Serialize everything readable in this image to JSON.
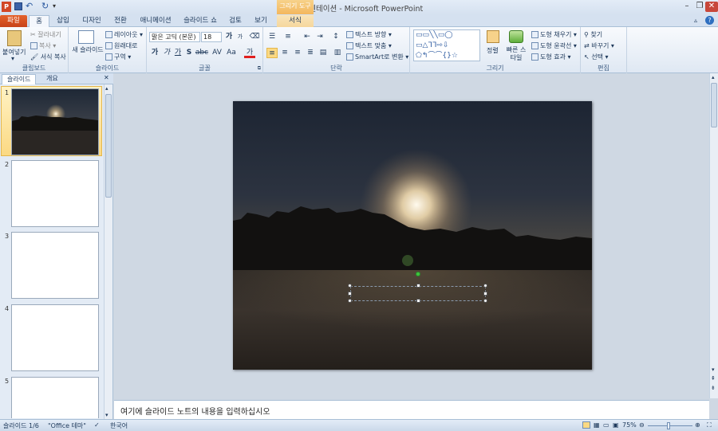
{
  "window": {
    "title": "프레젠테이션 - Microsoft PowerPoint",
    "context_tab_group": "그리기 도구"
  },
  "quick_access": [
    "save-icon",
    "undo-icon",
    "redo-icon",
    "customize-icon"
  ],
  "tabs": [
    "파일",
    "홈",
    "삽입",
    "디자인",
    "전환",
    "애니메이션",
    "슬라이드 쇼",
    "검토",
    "보기",
    "서식"
  ],
  "ribbon": {
    "clipboard": {
      "label": "클립보드",
      "paste": "붙여넣기",
      "cut": "잘라내기",
      "copy": "복사",
      "format_painter": "서식 복사"
    },
    "slides": {
      "label": "슬라이드",
      "new_slide": "새 슬라이드",
      "layout": "레이아웃",
      "reset": "원래대로",
      "section": "구역"
    },
    "font": {
      "label": "글꼴",
      "font_name": "맑은 고딕 (본문)",
      "font_size": "18",
      "grow": "가",
      "shrink": "가",
      "bold": "가",
      "italic": "가",
      "underline": "가",
      "shadow": "S",
      "strike": "abc",
      "spacing": "AV",
      "case": "Aa",
      "color": "가"
    },
    "paragraph": {
      "label": "단락",
      "text_direction": "텍스트 방향",
      "align_text": "텍스트 맞춤",
      "smartart": "SmartArt로 변환"
    },
    "drawing": {
      "label": "그리기",
      "arrange": "정렬",
      "quick_styles": "빠른 스타일",
      "shape_fill": "도형 채우기",
      "shape_outline": "도형 윤곽선",
      "shape_effects": "도형 효과"
    },
    "editing": {
      "label": "편집",
      "find": "찾기",
      "replace": "바꾸기",
      "select": "선택"
    }
  },
  "panel": {
    "tabs": [
      "슬라이드",
      "개요"
    ],
    "slide_numbers": [
      "1",
      "2",
      "3",
      "4",
      "5"
    ]
  },
  "notes": {
    "placeholder": "여기에 슬라이드 노트의 내용을 입력하십시오"
  },
  "status": {
    "slide": "슬라이드 1/6",
    "theme": "\"Office 테마\"",
    "language": "한국어",
    "zoom": "75%"
  }
}
